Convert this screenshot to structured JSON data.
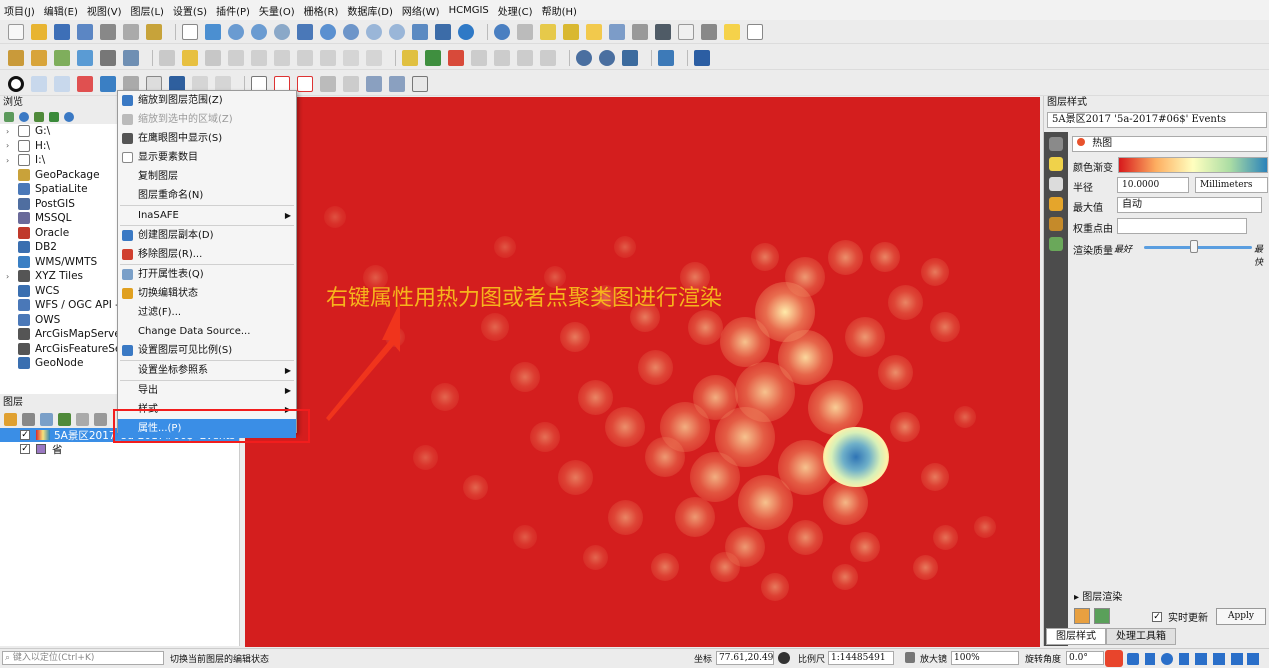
{
  "menubar": [
    "项目(J)",
    "编辑(E)",
    "视图(V)",
    "图层(L)",
    "设置(S)",
    "插件(P)",
    "矢量(O)",
    "栅格(R)",
    "数据库(D)",
    "网络(W)",
    "HCMGIS",
    "处理(C)",
    "帮助(H)"
  ],
  "browser": {
    "title": "浏览",
    "items": [
      "G:\\",
      "H:\\",
      "I:\\",
      "GeoPackage",
      "SpatiaLite",
      "PostGIS",
      "MSSQL",
      "Oracle",
      "DB2",
      "WMS/WMTS",
      "XYZ Tiles",
      "WCS",
      "WFS / OGC API -",
      "OWS",
      "ArcGisMapServe",
      "ArcGisFeatureSe",
      "GeoNode"
    ]
  },
  "layers": {
    "title": "图层",
    "rows": [
      "5A景区2017_5a-2017#06$' Events",
      "省"
    ]
  },
  "context_menu": {
    "items": [
      {
        "label": "缩放到图层范围(Z)",
        "disabled": false
      },
      {
        "label": "缩放到选中的区域(Z)",
        "disabled": true
      },
      {
        "label": "在鹰眼图中显示(S)",
        "disabled": false
      },
      {
        "label": "显示要素数目",
        "disabled": false
      },
      {
        "label": "复制图层",
        "disabled": false
      },
      {
        "label": "图层重命名(N)",
        "disabled": false
      },
      {
        "label": "InaSAFE",
        "disabled": false,
        "submenu": true
      },
      {
        "label": "创建图层副本(D)",
        "disabled": false
      },
      {
        "label": "移除图层(R)...",
        "disabled": false
      },
      {
        "label": "打开属性表(Q)",
        "disabled": false
      },
      {
        "label": "切换编辑状态",
        "disabled": false
      },
      {
        "label": "过滤(F)...",
        "disabled": false
      },
      {
        "label": "Change Data Source...",
        "disabled": false
      },
      {
        "label": "设置图层可见比例(S)",
        "disabled": false
      },
      {
        "label": "设置坐标参照系",
        "disabled": false,
        "submenu": true
      },
      {
        "label": "导出",
        "disabled": false,
        "submenu": true
      },
      {
        "label": "样式",
        "disabled": false,
        "submenu": true
      },
      {
        "label": "属性...(P)",
        "disabled": false,
        "highlighted": true
      }
    ]
  },
  "annotation": "右键属性用热力图或者点聚类图进行渲染",
  "style_panel": {
    "title": "图层样式",
    "layer_select": "5A景区2017 '5a-2017#06$' Events",
    "renderer": "热图",
    "color_ramp_label": "颜色渐变",
    "radius_label": "半径",
    "radius_value": "10.0000",
    "radius_unit": "Millimeters",
    "max_label": "最大值",
    "max_value": "自动",
    "weight_label": "权重点由",
    "quality_label": "渲染质量",
    "quality_best": "最好",
    "quality_fast": "最快",
    "layer_render": "图层渲染",
    "live_update": "实时更新",
    "apply": "Apply",
    "tab_style": "图层样式",
    "tab_toolbox": "处理工具箱"
  },
  "statusbar": {
    "locate_placeholder": "键入以定位(Ctrl+K)",
    "message": "切换当前图层的编辑状态",
    "coord_label": "坐标",
    "coord_value": "77.61,20.49",
    "scale_label": "比例尺",
    "scale_value": "1:14485491",
    "magnifier_label": "放大镜",
    "magnifier_value": "100%",
    "rotation_label": "旋转角度",
    "rotation_value": "0.0°"
  }
}
